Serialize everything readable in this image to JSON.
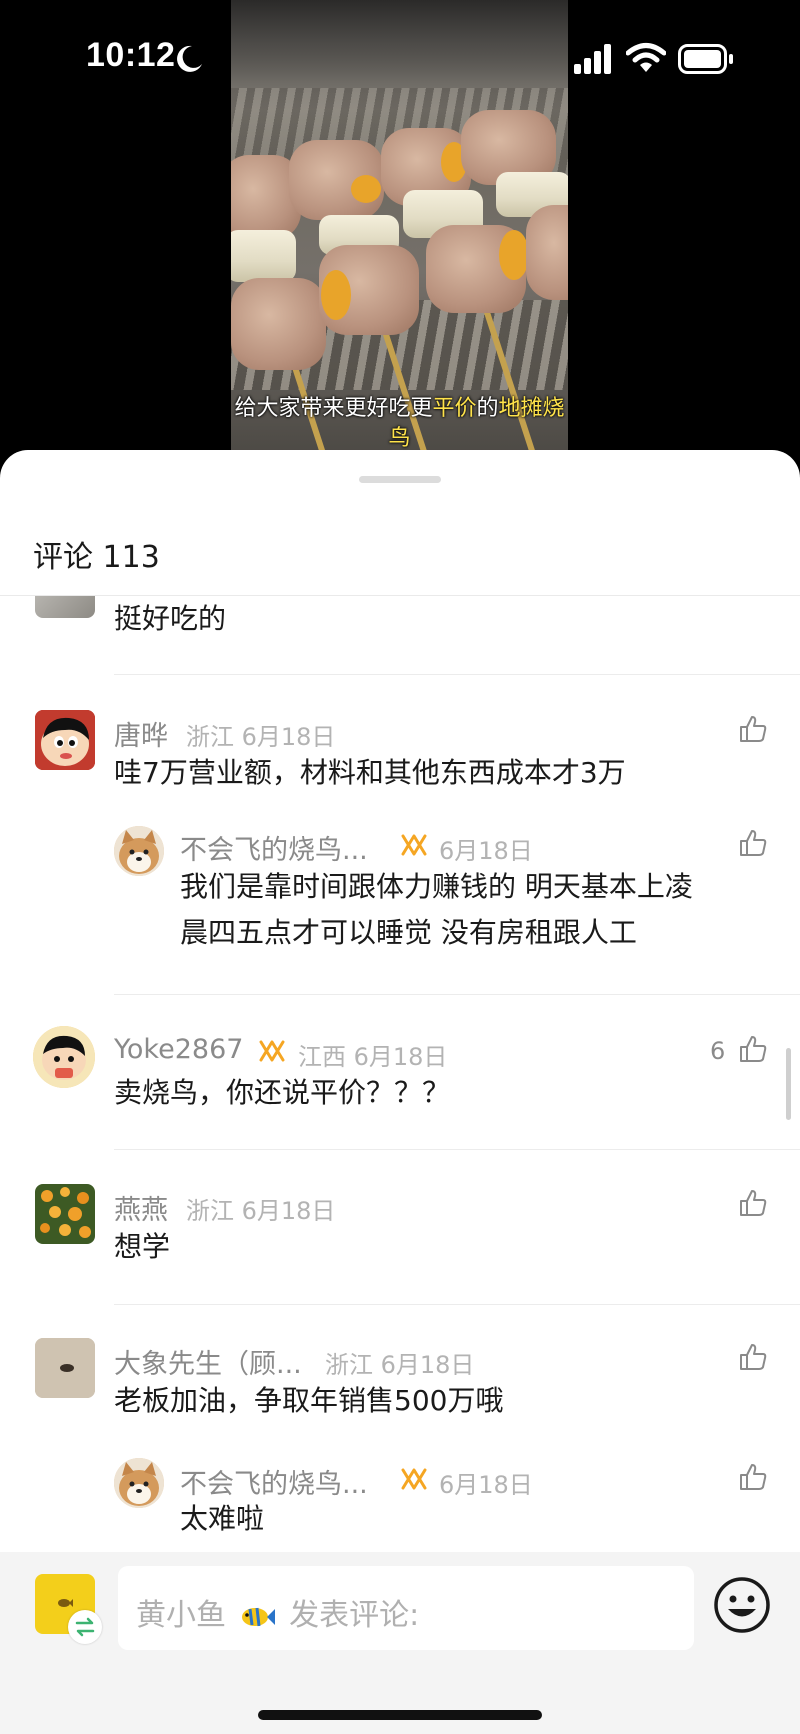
{
  "status_bar": {
    "time": "10:12"
  },
  "video": {
    "caption_part1": "给大家带来更好吃更",
    "caption_highlight1": "平价",
    "caption_part2": "的",
    "caption_highlight2": "地摊烧鸟"
  },
  "comments_panel": {
    "title": "评论 113",
    "partial_comment": {
      "text": "挺好吃的"
    },
    "comments": [
      {
        "username": "唐晔",
        "location_date": "浙江 6月18日",
        "text": "哇7万营业额，材料和其他东西成本才3万"
      },
      {
        "username": "Yoke2867",
        "location_date": "江西 6月18日",
        "likes": "6",
        "text": "卖烧鸟，你还说平价？？？"
      },
      {
        "username": "燕燕",
        "location_date": "浙江 6月18日",
        "text": "想学"
      },
      {
        "username": "大象先生（顾...",
        "location_date": "浙江 6月18日",
        "text": "老板加油，争取年销售500万哦"
      }
    ],
    "replies": [
      {
        "username": "不会飞的烧鸟...",
        "date": "6月18日",
        "text_line1": "我们是靠时间跟体力赚钱的 明天基本上凌",
        "text_line2": "晨四五点才可以睡觉 没有房租跟人工"
      },
      {
        "username": "不会飞的烧鸟...",
        "date": "6月18日",
        "text": "太难啦"
      }
    ]
  },
  "input_bar": {
    "placeholder_prefix": "黄小鱼",
    "placeholder_suffix": "发表评论:"
  },
  "colors": {
    "accent_badge": "#f5a623",
    "caption_highlight": "#ffe34a",
    "my_avatar": "#f3cf1b"
  }
}
